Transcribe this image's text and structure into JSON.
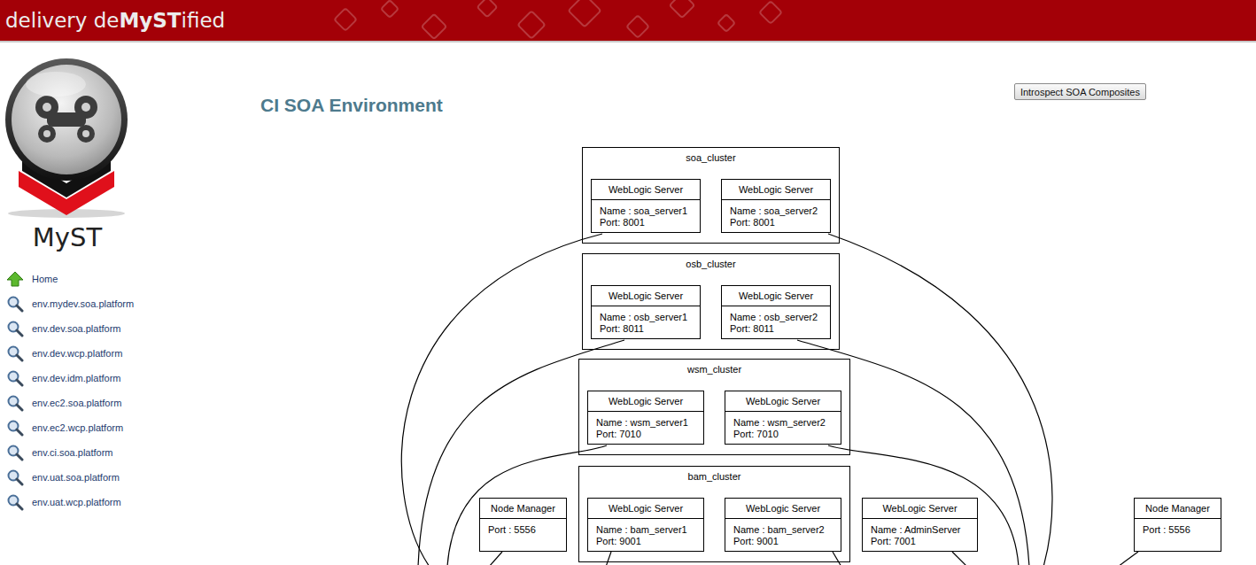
{
  "header": {
    "brand": [
      {
        "text": "delivery de",
        "bold": false
      },
      {
        "text": "MyST",
        "bold": true
      },
      {
        "text": "ified",
        "bold": false
      }
    ]
  },
  "logo": {
    "label": "MyST"
  },
  "sidebar": {
    "items": [
      {
        "label": "Home",
        "kind": "home"
      },
      {
        "label": "env.mydev.soa.platform",
        "kind": "env"
      },
      {
        "label": "env.dev.soa.platform",
        "kind": "env"
      },
      {
        "label": "env.dev.wcp.platform",
        "kind": "env"
      },
      {
        "label": "env.dev.idm.platform",
        "kind": "env"
      },
      {
        "label": "env.ec2.soa.platform",
        "kind": "env"
      },
      {
        "label": "env.ec2.wcp.platform",
        "kind": "env"
      },
      {
        "label": "env.ci.soa.platform",
        "kind": "env"
      },
      {
        "label": "env.uat.soa.platform",
        "kind": "env"
      },
      {
        "label": "env.uat.wcp.platform",
        "kind": "env"
      }
    ]
  },
  "page": {
    "title": "CI SOA Environment",
    "button": "Introspect SOA Composites"
  },
  "diagram": {
    "clusters": [
      {
        "name": "soa_cluster",
        "servers": [
          {
            "type": "WebLogic Server",
            "lines": [
              "Name : soa_server1",
              "Port: 8001"
            ]
          },
          {
            "type": "WebLogic Server",
            "lines": [
              "Name : soa_server2",
              "Port: 8001"
            ]
          }
        ]
      },
      {
        "name": "osb_cluster",
        "servers": [
          {
            "type": "WebLogic Server",
            "lines": [
              "Name : osb_server1",
              "Port: 8011"
            ]
          },
          {
            "type": "WebLogic Server",
            "lines": [
              "Name : osb_server2",
              "Port: 8011"
            ]
          }
        ]
      },
      {
        "name": "wsm_cluster",
        "servers": [
          {
            "type": "WebLogic Server",
            "lines": [
              "Name : wsm_server1",
              "Port: 7010"
            ]
          },
          {
            "type": "WebLogic Server",
            "lines": [
              "Name : wsm_server2",
              "Port: 7010"
            ]
          }
        ]
      },
      {
        "name": "bam_cluster",
        "servers": [
          {
            "type": "WebLogic Server",
            "lines": [
              "Name : bam_server1",
              "Port: 9001"
            ]
          },
          {
            "type": "WebLogic Server",
            "lines": [
              "Name : bam_server2",
              "Port: 9001"
            ]
          }
        ]
      }
    ],
    "nodes": [
      {
        "type": "Node Manager",
        "lines": [
          "Port : 5556"
        ]
      },
      {
        "type": "WebLogic Server",
        "lines": [
          "Name : AdminServer",
          "Port: 7001"
        ]
      },
      {
        "type": "Node Manager",
        "lines": [
          "Port : 5556"
        ]
      }
    ]
  }
}
